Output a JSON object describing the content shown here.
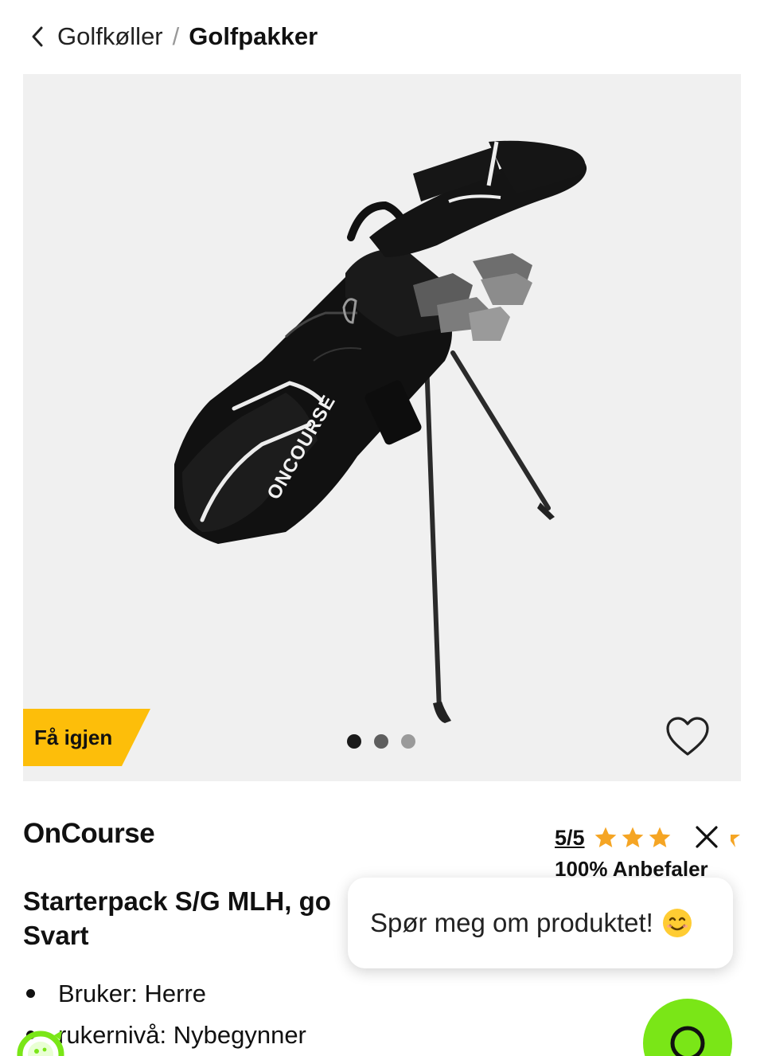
{
  "breadcrumb": {
    "parent": "Golfkøller",
    "separator": "/",
    "current": "Golfpakker"
  },
  "gallery": {
    "badge": "Få igjen",
    "badge_color": "#fdbe0a",
    "background": "#f0f0f0",
    "image_logo_text": "ONCOURSE",
    "total_images": 3,
    "active_image": 1
  },
  "product": {
    "brand": "OnCourse",
    "title": "Starterpack S/G MLH, go",
    "title_line2": "Svart",
    "rating": "5/5",
    "stars": 5,
    "recommend": "100% Anbefaler",
    "features": [
      "Bruker: Herre",
      "rukernivå: Nybegynner"
    ]
  },
  "chat": {
    "prompt": "Spør meg om produktet!",
    "accent": "#7ae617"
  },
  "colors": {
    "star": "#f5a524",
    "text": "#111111"
  },
  "icons": [
    "chevron-left-icon",
    "heart-icon",
    "star-icon",
    "close-icon",
    "smile-emoji-icon",
    "chat-bubble-icon",
    "eco-leaf-icon"
  ]
}
